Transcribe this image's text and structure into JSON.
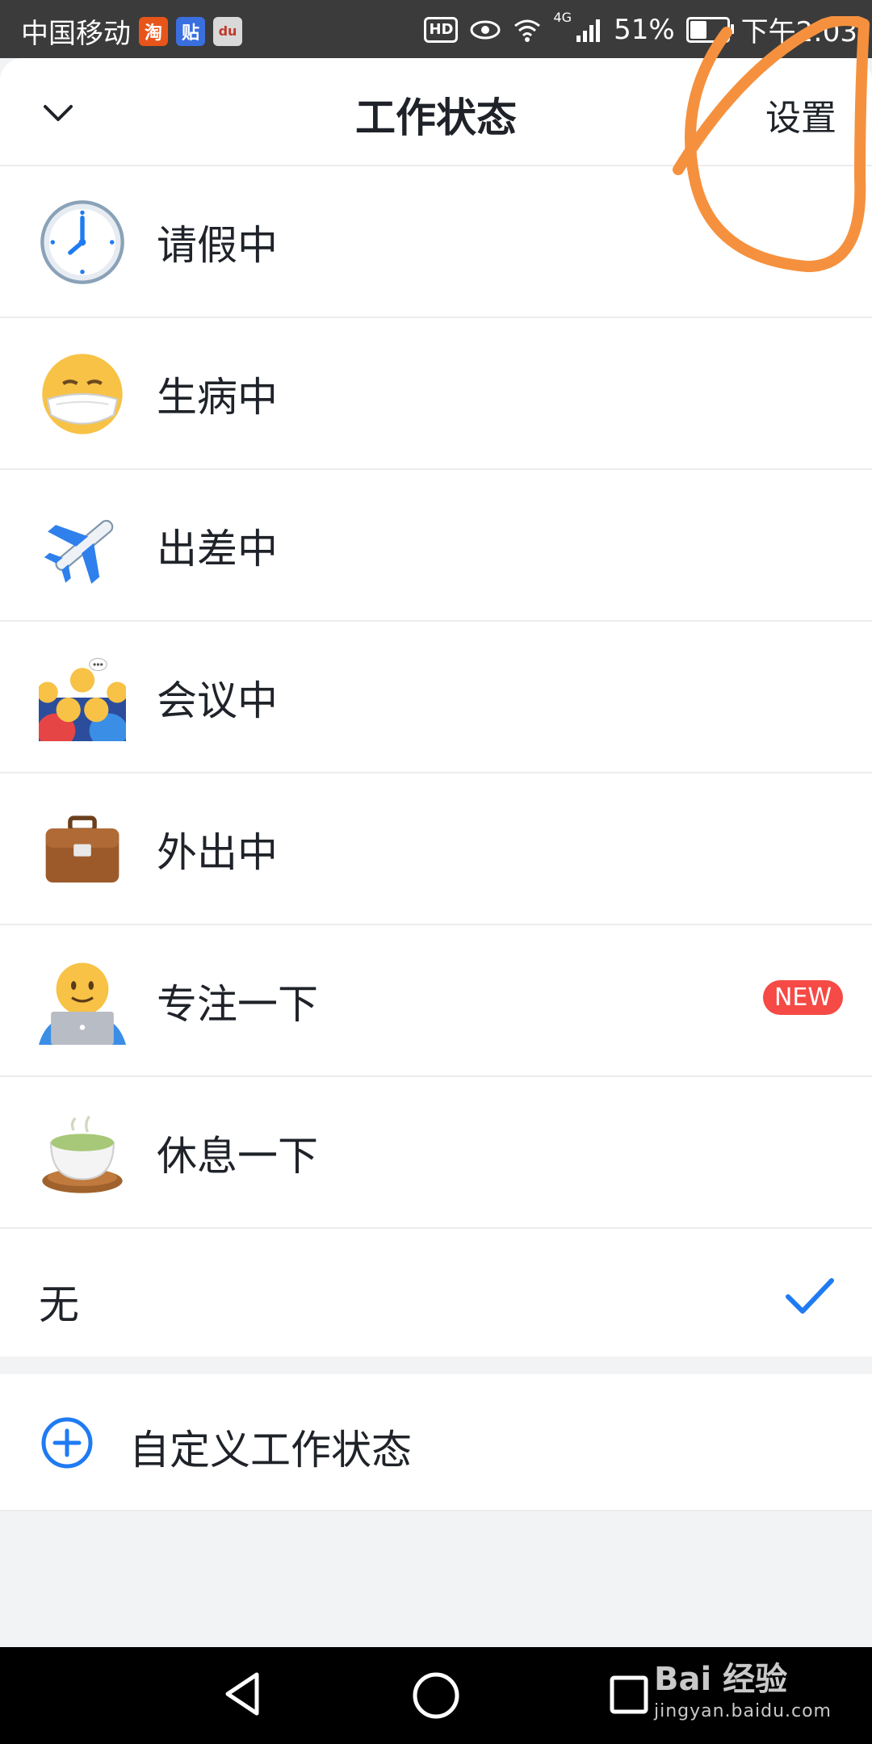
{
  "status_bar": {
    "carrier": "中国移动",
    "app_badges": [
      {
        "name": "taobao-icon",
        "text": "淘",
        "color": "#e8551a"
      },
      {
        "name": "tieba-icon",
        "text": "贴",
        "color": "#3a6fe0"
      },
      {
        "name": "baidu-map-icon",
        "text": "du",
        "color": "#d9d9d9"
      }
    ],
    "hd": "HD",
    "network": "4G",
    "battery": "51%",
    "battery_level": 0.51,
    "time": "下午2:03"
  },
  "header": {
    "title": "工作状态",
    "settings_label": "设置",
    "collapse_icon": "chevron-down-icon"
  },
  "statuses": [
    {
      "label": "请假中",
      "icon": "clock-icon"
    },
    {
      "label": "生病中",
      "icon": "mask-face-icon"
    },
    {
      "label": "出差中",
      "icon": "airplane-icon"
    },
    {
      "label": "会议中",
      "icon": "meeting-people-icon"
    },
    {
      "label": "外出中",
      "icon": "briefcase-icon"
    },
    {
      "label": "专注一下",
      "icon": "laptop-person-icon",
      "badge": "NEW"
    },
    {
      "label": "休息一下",
      "icon": "tea-icon"
    }
  ],
  "none_option": {
    "label": "无",
    "selected": true
  },
  "custom_status": {
    "label": "自定义工作状态",
    "icon": "plus-circle-icon"
  },
  "colors": {
    "accent": "#1f7bf2",
    "badge": "#f54a45",
    "annotation": "#f5913e"
  },
  "watermark": {
    "title": "Bai 经验",
    "url": "jingyan.baidu.com"
  }
}
